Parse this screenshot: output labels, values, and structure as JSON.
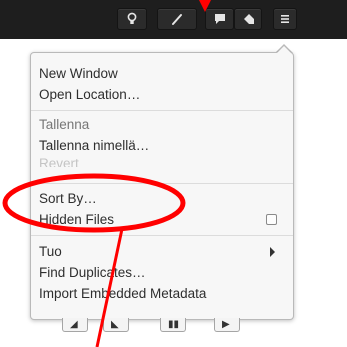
{
  "menu": {
    "items": [
      {
        "label": "New Window",
        "state": "normal"
      },
      {
        "label": "Open Location…",
        "state": "normal"
      },
      {
        "label": "Tallenna",
        "state": "dim"
      },
      {
        "label": "Tallenna nimellä…",
        "state": "normal"
      },
      {
        "label": "Revert",
        "state": "faded"
      },
      {
        "label": "Sort By…",
        "state": "normal"
      },
      {
        "label": "Hidden Files",
        "state": "normal",
        "control": "checkbox",
        "checked": false
      },
      {
        "label": "Tuo",
        "state": "normal",
        "control": "submenu"
      },
      {
        "label": "Find Duplicates…",
        "state": "normal"
      },
      {
        "label": "Import Embedded Metadata",
        "state": "normal"
      }
    ]
  },
  "header": {
    "buttons": [
      {
        "icon": "lightbulb-icon"
      },
      {
        "icon": "pen-icon"
      },
      {
        "icon": "comment-icon"
      },
      {
        "icon": "tag-icon"
      },
      {
        "icon": "hamburger-menu-icon"
      }
    ]
  },
  "colors": {
    "annotation": "#ff0000",
    "headerbar": "#1e1e1e",
    "menu_bg": "#f7f7f7"
  }
}
